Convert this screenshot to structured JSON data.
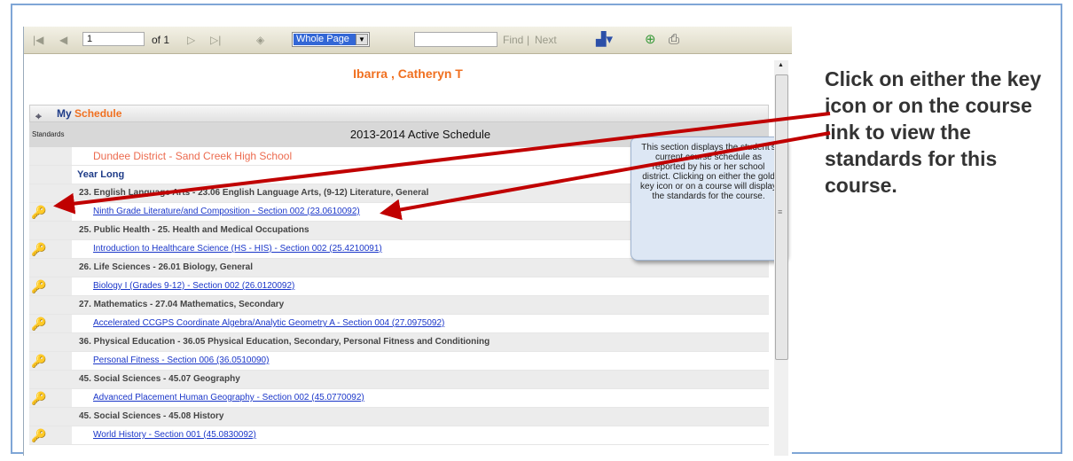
{
  "toolbar": {
    "page_value": "1",
    "page_of": "of 1",
    "zoom_value": "Whole Page",
    "find_label": "Find",
    "separator": "|",
    "next_label": "Next"
  },
  "student_name": "Ibarra , Catheryn T",
  "schedule": {
    "my_label": "My",
    "schedule_label": "Schedule",
    "standards_header": "Standards",
    "title": "2013-2014 Active Schedule",
    "district": "Dundee District - Sand Creek High School",
    "period": "Year Long",
    "courses": [
      {
        "category": "23. English Language Arts - 23.06 English Language Arts, (9-12) Literature, General",
        "link": "Ninth Grade Literature/and Composition  - Section 002 (23.0610092)"
      },
      {
        "category": "25. Public Health - 25. Health and Medical Occupations",
        "link": "Introduction to Healthcare Science (HS - HIS) - Section 002 (25.4210091)"
      },
      {
        "category": "26. Life Sciences - 26.01 Biology, General",
        "link": "Biology I (Grades 9-12)  - Section 002 (26.0120092)"
      },
      {
        "category": "27. Mathematics - 27.04 Mathematics, Secondary",
        "link": "Accelerated CCGPS Coordinate Algebra/Analytic Geometry A - Section 004 (27.0975092)"
      },
      {
        "category": "36. Physical Education - 36.05 Physical Education, Secondary, Personal Fitness and Conditioning",
        "link": "Personal Fitness  - Section 006 (36.0510090)"
      },
      {
        "category": "45. Social Sciences - 45.07 Geography",
        "link": "Advanced Placement Human Geography  - Section 002 (45.0770092)"
      },
      {
        "category": "45. Social Sciences - 45.08 History",
        "link": "World History  - Section 001 (45.0830092)"
      }
    ]
  },
  "callout_text": "This section displays the student's current course schedule as reported by his or her school district. Clicking on either the gold key icon or on a course will display the standards for the course.",
  "annotation_text": "Click on either the key icon or on the course link to view the standards for this course.",
  "colors": {
    "student_name": "#f07020",
    "link": "#1a36c9",
    "arrow": "#c00000",
    "key": "#d4a017"
  },
  "icons": [
    "first-page-icon",
    "prev-page-icon",
    "next-page-icon",
    "last-page-icon",
    "back-icon",
    "save-export-icon",
    "refresh-icon",
    "print-icon",
    "key-icon"
  ]
}
